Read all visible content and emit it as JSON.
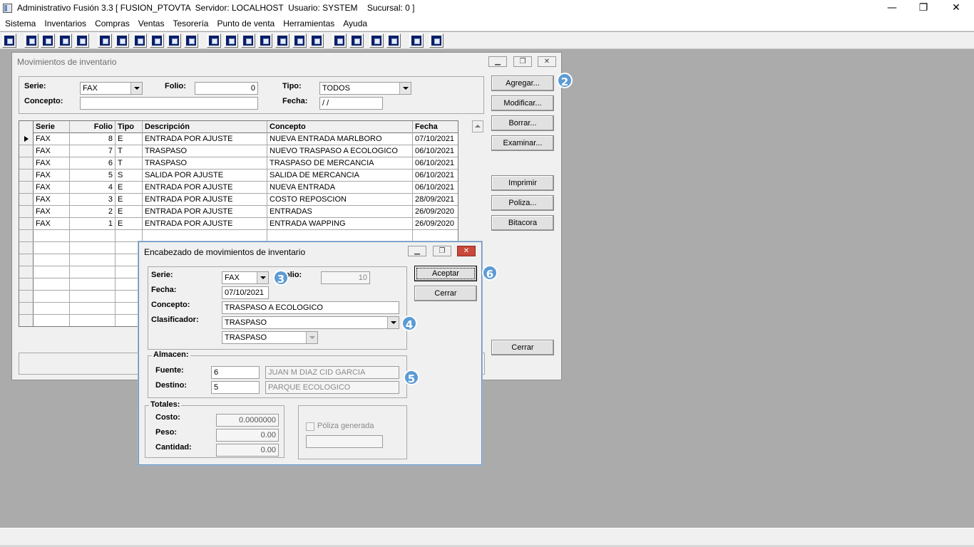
{
  "app": {
    "title": "Administrativo Fusión 3.3 [ FUSION_PTOVTA  Servidor: LOCALHOST  Usuario: SYSTEM    Sucursal: 0 ]",
    "window_controls": {
      "minimize": "—",
      "restore": "❐",
      "close": "✕"
    }
  },
  "menu": [
    "Sistema",
    "Inventarios",
    "Compras",
    "Ventas",
    "Tesorería",
    "Punto de venta",
    "Herramientas",
    "Ayuda"
  ],
  "toolbar_icons": [
    "calc-icon",
    "window-icon",
    "document-icon",
    "transfer-icon",
    "search-icon",
    "user-icon",
    "folder-icon",
    "print-icon",
    "print-preview-icon",
    "report-icon",
    "list-icon",
    "group-icon",
    "box-icon",
    "export-icon",
    "add-icon",
    "money-icon",
    "invoice-icon",
    "table-icon",
    "home-icon",
    "zoom-icon",
    "refresh-icon",
    "undo-icon",
    "back-icon",
    "help-icon"
  ],
  "main_window": {
    "title": "Movimientos de inventario",
    "filters": {
      "serie_label": "Serie:",
      "serie_value": "FAX",
      "folio_label": "Folio:",
      "folio_value": "0",
      "tipo_label": "Tipo:",
      "tipo_value": "TODOS",
      "concepto_label": "Concepto:",
      "concepto_value": "",
      "fecha_label": "Fecha:",
      "fecha_value": " / /"
    },
    "buttons": {
      "agregar": "Agregar...",
      "modificar": "Modificar...",
      "borrar": "Borrar...",
      "examinar": "Examinar...",
      "imprimir": "Imprimir",
      "poliza": "Poliza...",
      "bitacora": "Bitacora",
      "cerrar": "Cerrar"
    },
    "table": {
      "columns": [
        "Serie",
        "Folio",
        "Tipo",
        "Descripción",
        "Concepto",
        "Fecha"
      ],
      "rows": [
        [
          "FAX",
          "8",
          "E",
          "ENTRADA POR AJUSTE",
          "NUEVA ENTRADA MARLBORO",
          "07/10/2021"
        ],
        [
          "FAX",
          "7",
          "T",
          "TRASPASO",
          "NUEVO TRASPASO A ECOLOGICO",
          "06/10/2021"
        ],
        [
          "FAX",
          "6",
          "T",
          "TRASPASO",
          "TRASPASO DE MERCANCIA",
          "06/10/2021"
        ],
        [
          "FAX",
          "5",
          "S",
          "SALIDA POR AJUSTE",
          "SALIDA DE MERCANCIA",
          "06/10/2021"
        ],
        [
          "FAX",
          "4",
          "E",
          "ENTRADA POR AJUSTE",
          "NUEVA ENTRADA",
          "06/10/2021"
        ],
        [
          "FAX",
          "3",
          "E",
          "ENTRADA POR AJUSTE",
          "COSTO REPOSCION",
          "28/09/2021"
        ],
        [
          "FAX",
          "2",
          "E",
          "ENTRADA POR AJUSTE",
          "ENTRADAS",
          "26/09/2020"
        ],
        [
          "FAX",
          "1",
          "E",
          "ENTRADA POR AJUSTE",
          "ENTRADA WAPPING",
          "26/09/2020"
        ]
      ]
    }
  },
  "dialog": {
    "title": "Encabezado de movimientos de inventario",
    "serie_label": "Serie:",
    "serie_value": "FAX",
    "folio_label": "olio:",
    "folio_value": "10",
    "fecha_label": "Fecha:",
    "fecha_value": "07/10/2021",
    "concepto_label": "Concepto:",
    "concepto_value": "TRASPASO A ECOLOGICO",
    "clasificador_label": "Clasificador:",
    "clasificador_value": "TRASPASO",
    "clasificador2_value": "TRASPASO",
    "almacen_label": "Almacen:",
    "fuente_label": "Fuente:",
    "fuente_code": "6",
    "fuente_name": "JUAN M DIAZ CID GARCIA",
    "destino_label": "Destino:",
    "destino_code": "5",
    "destino_name": "PARQUE ECOLOGICO",
    "totales_label": "Totales:",
    "costo_label": "Costo:",
    "costo_value": "0.0000000",
    "peso_label": "Peso:",
    "peso_value": "0.00",
    "cantidad_label": "Cantidad:",
    "cantidad_value": "0.00",
    "poliza_label": "Póliza generada",
    "aceptar": "Aceptar",
    "cerrar": "Cerrar"
  },
  "badges": [
    "2",
    "3",
    "4",
    "5",
    "6"
  ],
  "colors": {
    "badge": "#5b9bd5",
    "window_bg": "#f0f0f0",
    "desktop": "#ababab",
    "close_red": "#c9483a"
  }
}
